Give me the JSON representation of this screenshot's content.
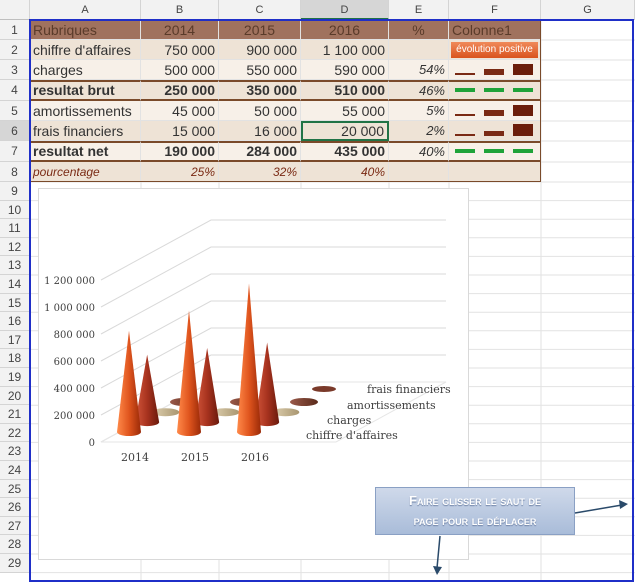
{
  "columns": [
    "A",
    "B",
    "C",
    "D",
    "E",
    "F",
    "G"
  ],
  "rows": [
    "1",
    "2",
    "3",
    "4",
    "5",
    "6",
    "7",
    "8",
    "9",
    "10",
    "11",
    "12",
    "13",
    "14",
    "15",
    "16",
    "17",
    "18",
    "19",
    "20",
    "21",
    "22",
    "23",
    "24",
    "25",
    "26",
    "27",
    "28",
    "29"
  ],
  "table": {
    "header": [
      "Rubriques",
      "2014",
      "2015",
      "2016",
      "%",
      "Colonne1"
    ],
    "rows": [
      {
        "label": "chiffre d'affaires",
        "v2014": "750 000",
        "v2015": "900 000",
        "v2016": "1 100 000",
        "pct": "",
        "spark": "évolution positive"
      },
      {
        "label": "charges",
        "v2014": "500 000",
        "v2015": "550 000",
        "v2016": "590 000",
        "pct": "54%",
        "spark": ""
      },
      {
        "label": "resultat brut",
        "v2014": "250 000",
        "v2015": "350 000",
        "v2016": "510 000",
        "pct": "46%",
        "spark": ""
      },
      {
        "label": "amortissements",
        "v2014": "45 000",
        "v2015": "50 000",
        "v2016": "55 000",
        "pct": "5%",
        "spark": ""
      },
      {
        "label": "frais financiers",
        "v2014": "15 000",
        "v2015": "16 000",
        "v2016": "20 000",
        "pct": "2%",
        "spark": ""
      },
      {
        "label": "resultat net",
        "v2014": "190 000",
        "v2015": "284 000",
        "v2016": "435 000",
        "pct": "40%",
        "spark": ""
      },
      {
        "label": "pourcentage",
        "v2014": "25%",
        "v2015": "32%",
        "v2016": "40%",
        "pct": "",
        "spark": ""
      }
    ]
  },
  "chart_data": {
    "type": "bar",
    "style": "3d-cone",
    "categories": [
      "2014",
      "2015",
      "2016"
    ],
    "series": [
      {
        "name": "chiffre d'affaires",
        "values": [
          750000,
          900000,
          1100000
        ]
      },
      {
        "name": "charges",
        "values": [
          500000,
          550000,
          590000
        ]
      },
      {
        "name": "amortissements",
        "values": [
          45000,
          50000,
          55000
        ]
      },
      {
        "name": "frais financiers",
        "values": [
          15000,
          16000,
          20000
        ]
      }
    ],
    "yticks": [
      "0",
      "200 000",
      "400 000",
      "600 000",
      "800 000",
      "1 000 000",
      "1 200 000"
    ],
    "ylim": [
      0,
      1200000
    ],
    "colors": [
      "#e0551e",
      "#a8331f",
      "#c9b896",
      "#7a3a2a"
    ]
  },
  "callout": {
    "line1": "Faire glisser le saut de",
    "line2": "page pour le déplacer"
  },
  "colors": {
    "accent": "#1f2fc8",
    "header": "#a0725e",
    "selection": "#217346"
  }
}
